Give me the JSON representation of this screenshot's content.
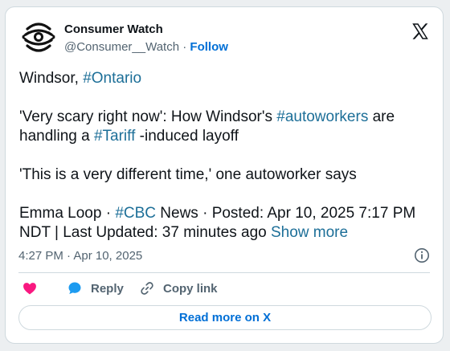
{
  "author": {
    "name": "Consumer Watch",
    "handle": "@Consumer__Watch",
    "separator": "·",
    "follow_label": "Follow",
    "avatar_icon": "consumer-watch-logo"
  },
  "tweet": {
    "line1": {
      "text": "Windsor, ",
      "tag": "#Ontario"
    },
    "line2": {
      "part1": "'Very scary right now': How Windsor's ",
      "tag1": "#autoworkers",
      "part2": " are handling a ",
      "tag2": "#Tariff",
      "part3": " -induced layoff"
    },
    "line3": "'This is a very different time,' one autoworker says",
    "line4": {
      "part1": "Emma Loop · ",
      "tag": "#CBC",
      "part2": " News · Posted: Apr 10, 2025 7:17 PM NDT | Last Updated: 37 minutes ago ",
      "show_more": "Show more"
    }
  },
  "meta": {
    "time": "4:27 PM · Apr 10, 2025"
  },
  "actions": {
    "like_icon": "heart-icon",
    "reply_label": "Reply",
    "copy_label": "Copy link"
  },
  "read_more_label": "Read more on X",
  "colors": {
    "link": "#1d6f98",
    "accent": "#006fd6",
    "like": "#f91880",
    "reply": "#1d9bf0"
  }
}
